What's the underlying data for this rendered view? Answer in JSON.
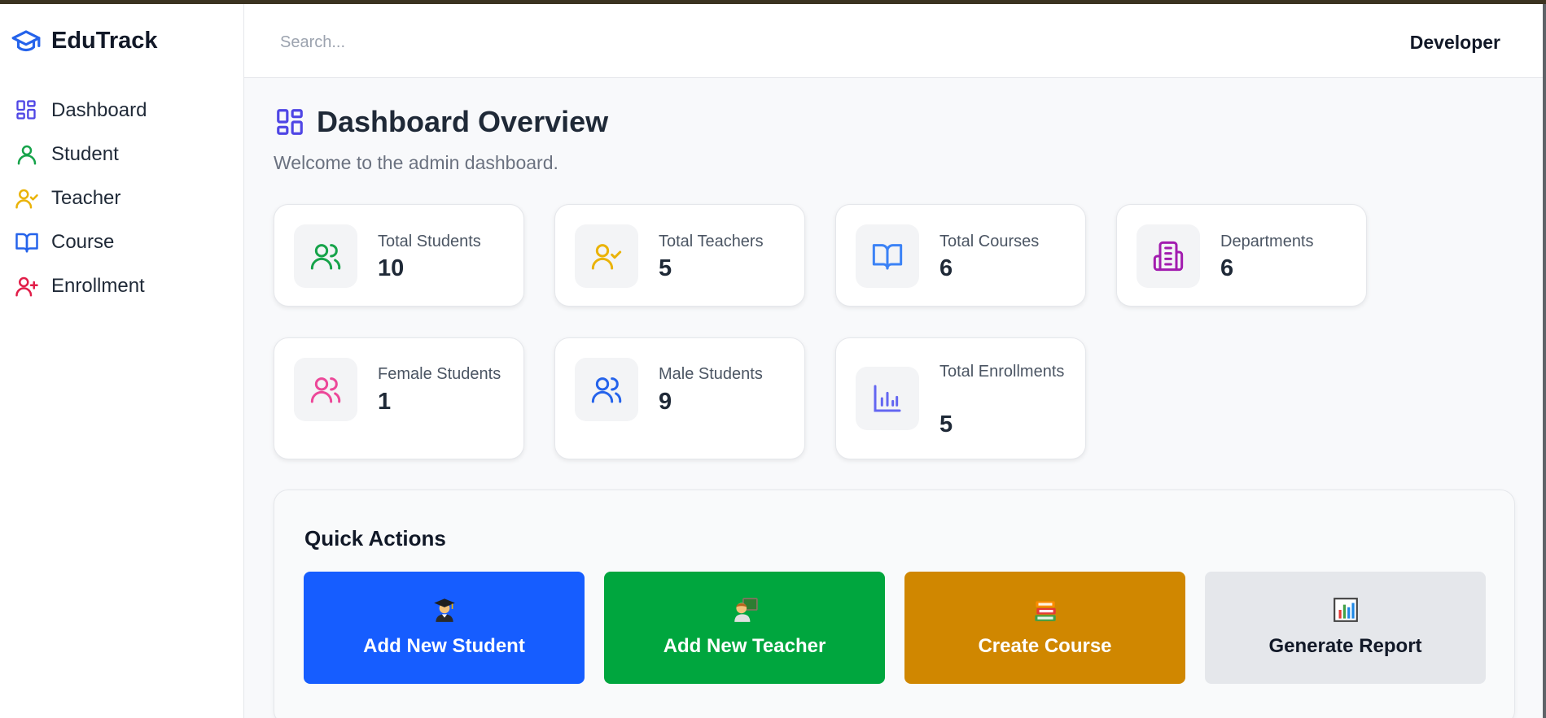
{
  "app": {
    "name": "EduTrack"
  },
  "sidebar": {
    "items": [
      {
        "label": "Dashboard",
        "icon": "dashboard-grid-icon",
        "color": "#4f46e5"
      },
      {
        "label": "Student",
        "icon": "user-icon",
        "color": "#16a34a"
      },
      {
        "label": "Teacher",
        "icon": "user-check-icon",
        "color": "#eab308"
      },
      {
        "label": "Course",
        "icon": "book-open-icon",
        "color": "#2563eb"
      },
      {
        "label": "Enrollment",
        "icon": "user-plus-icon",
        "color": "#e11d48"
      }
    ]
  },
  "header": {
    "search_placeholder": "Search...",
    "user": "Developer"
  },
  "main": {
    "title": "Dashboard Overview",
    "subtitle": "Welcome to the admin dashboard.",
    "stats": [
      {
        "label": "Total Students",
        "value": "10",
        "icon": "users-icon",
        "color": "#16a34a"
      },
      {
        "label": "Total Teachers",
        "value": "5",
        "icon": "user-check-icon",
        "color": "#eab308"
      },
      {
        "label": "Total Courses",
        "value": "6",
        "icon": "book-open-icon",
        "color": "#3b82f6"
      },
      {
        "label": "Departments",
        "value": "6",
        "icon": "building-icon",
        "color": "#a21caf"
      },
      {
        "label": "Female Students",
        "value": "1",
        "icon": "users-icon",
        "color": "#ec4899"
      },
      {
        "label": "Male Students",
        "value": "9",
        "icon": "users-icon",
        "color": "#2563eb"
      },
      {
        "label": "Total Enrollments",
        "value": "5",
        "icon": "bar-chart-icon",
        "color": "#6366f1"
      }
    ]
  },
  "quick_actions": {
    "title": "Quick Actions",
    "buttons": [
      {
        "label": "Add New Student",
        "icon": "graduate-emoji-icon",
        "bg": "#165dff",
        "fg": "#ffffff"
      },
      {
        "label": "Add New Teacher",
        "icon": "teacher-emoji-icon",
        "bg": "#00a63e",
        "fg": "#ffffff"
      },
      {
        "label": "Create Course",
        "icon": "books-emoji-icon",
        "bg": "#d08700",
        "fg": "#ffffff"
      },
      {
        "label": "Generate Report",
        "icon": "bar-chart-emoji-icon",
        "bg": "#e5e7eb",
        "fg": "#111827"
      }
    ]
  }
}
